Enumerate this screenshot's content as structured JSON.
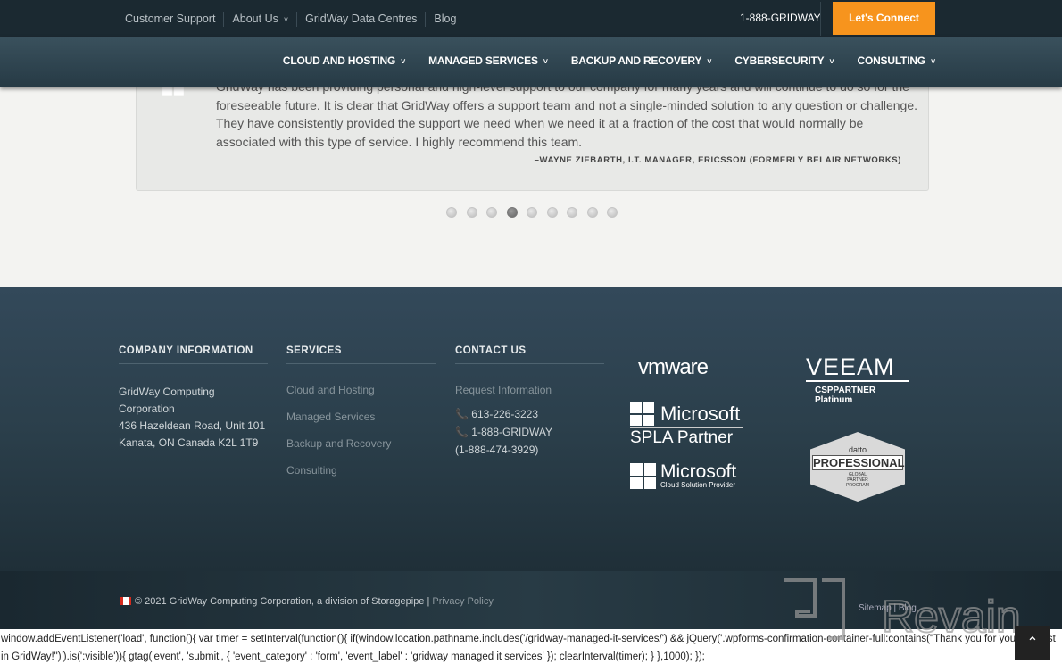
{
  "topbar": {
    "links": [
      "Customer Support",
      "About Us",
      "GridWay Data Centres",
      "Blog"
    ],
    "phone": "1-888-GRIDWAY",
    "cta": "Let's Connect"
  },
  "nav": {
    "items": [
      "CLOUD AND HOSTING",
      "MANAGED SERVICES",
      "BACKUP AND RECOVERY",
      "CYBERSECURITY",
      "CONSULTING"
    ]
  },
  "testimonial": {
    "text": "GridWay has been providing personal and high-level support to our company for many years and will continue to do so for the foreseeable future. It is clear that GridWay offers a support team and not a single-minded solution to any question or challenge. They have consistently provided the support we need when we need it at a fraction of the cost that would normally be associated with this type of service. I highly recommend this team.",
    "author": "–WAYNE ZIEBARTH, I.T. MANAGER, ERICSSON (FORMERLY BELAIR NETWORKS)",
    "dots": 9,
    "active_dot": 4
  },
  "footer": {
    "company": {
      "title": "COMPANY INFORMATION",
      "lines": [
        "GridWay Computing Corporation",
        "436 Hazeldean Road, Unit 101",
        "Kanata, ON Canada K2L 1T9"
      ]
    },
    "services": {
      "title": "SERVICES",
      "links": [
        "Cloud and Hosting",
        "Managed Services",
        "Backup and Recovery",
        "Consulting"
      ]
    },
    "contact": {
      "title": "CONTACT US",
      "request": "Request Information",
      "phone1": "613-226-3223",
      "phone2": "1-888-GRIDWAY",
      "phone2_alt": "(1-888-474-3929)"
    },
    "logos": {
      "vmware": "vmware",
      "veeam": "VEEAM",
      "veeam_sub1": "CSPPARTNER",
      "veeam_sub2": "Platinum",
      "ms1": "Microsoft",
      "ms1_sub": "SPLA Partner",
      "ms2": "Microsoft",
      "ms2_sub": "Cloud Solution Provider",
      "datto": "datto",
      "datto_main": "PROFESSIONAL",
      "datto_sub": "GLOBAL PARTNER PROGRAM"
    }
  },
  "bottom": {
    "copyright": "© 2021 GridWay Computing Corporation, a division of Storagepipe | ",
    "privacy": "Privacy Policy",
    "sitemap": "Sitemap | Blog"
  },
  "code_text": "window.addEventListener('load', function(){ var timer = setInterval(function(){ if(window.location.pathname.includes('/gridway-managed-it-services/') && jQuery('.wpforms-confirmation-container-full:contains(\"Thank you for your interest in GridWay!\")').is(':visible')){ gtag('event', 'submit', { 'event_category' : 'form', 'event_label' : 'gridway managed it services' }); clearInterval(timer); } },1000); });",
  "watermark": "Revain"
}
